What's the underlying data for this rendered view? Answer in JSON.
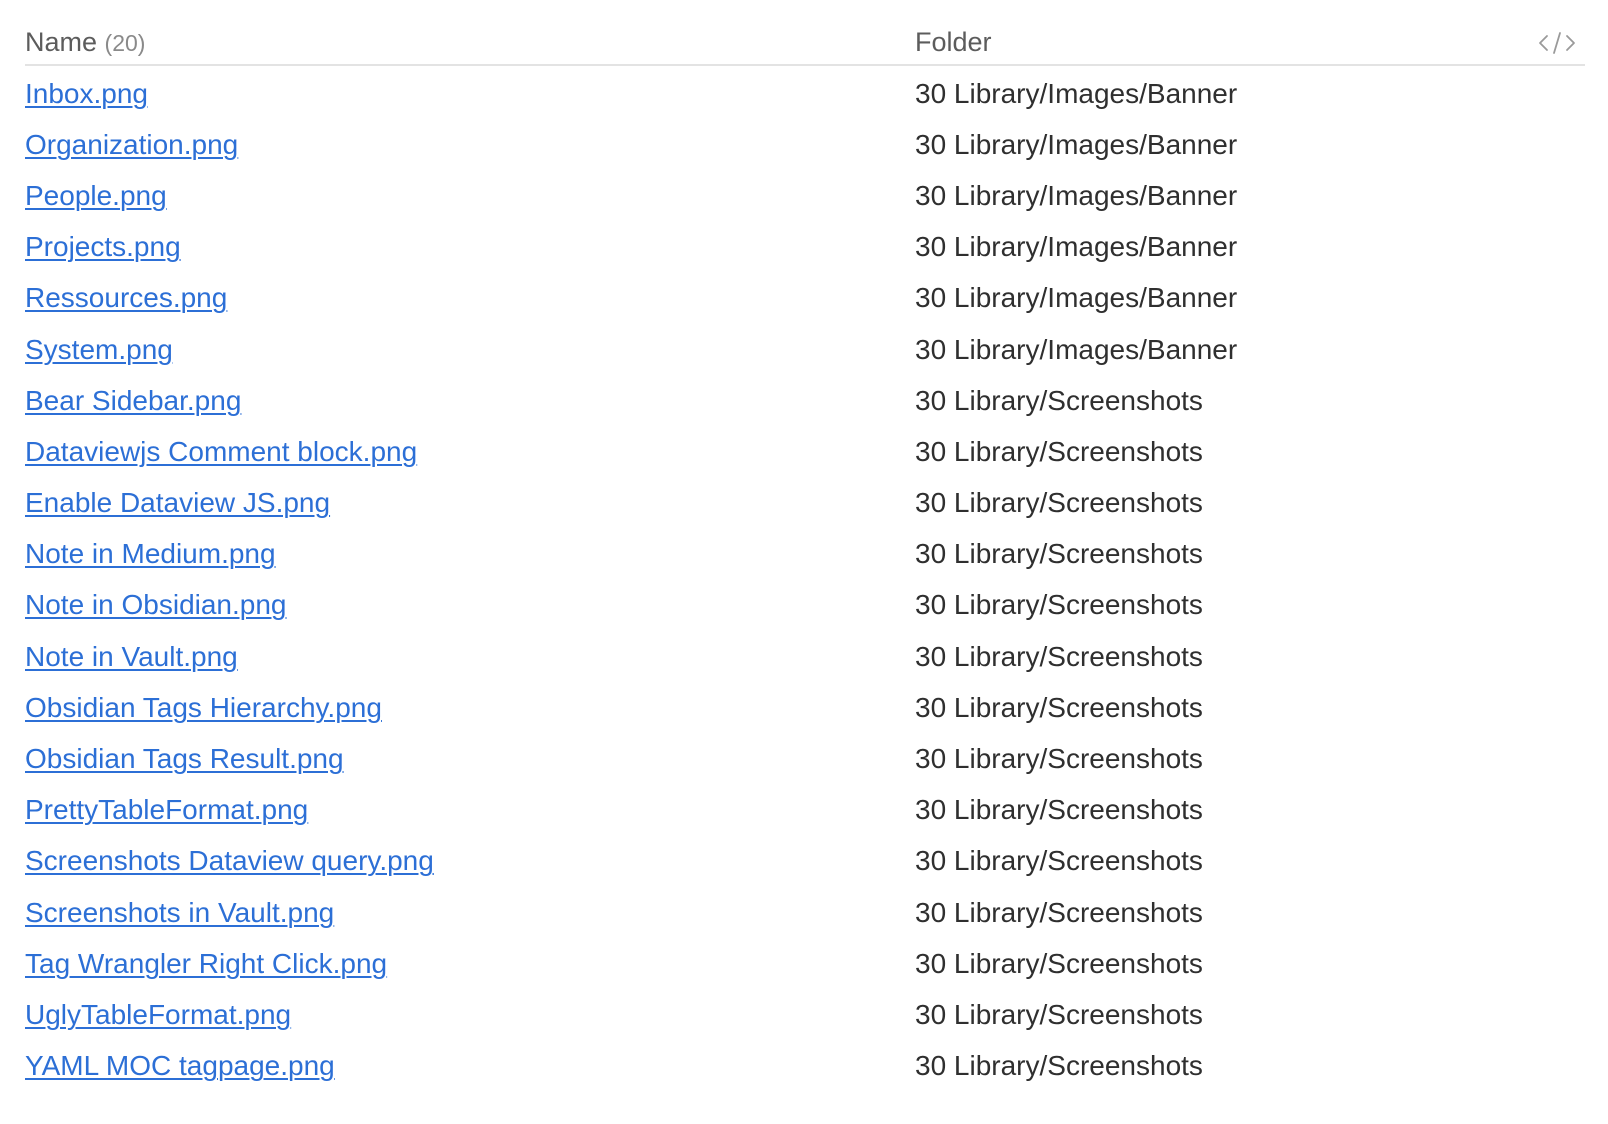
{
  "header": {
    "name_label": "Name",
    "count": "(20)",
    "folder_label": "Folder",
    "code_icon": "code-icon"
  },
  "colors": {
    "link": "#2c6fd6",
    "text": "#2f2f2f",
    "header": "#5c5c5c",
    "divider": "#e3e3e3"
  },
  "rows": [
    {
      "name": "Inbox.png",
      "folder": "30 Library/Images/Banner"
    },
    {
      "name": "Organization.png",
      "folder": "30 Library/Images/Banner"
    },
    {
      "name": "People.png",
      "folder": "30 Library/Images/Banner"
    },
    {
      "name": "Projects.png",
      "folder": "30 Library/Images/Banner"
    },
    {
      "name": "Ressources.png",
      "folder": "30 Library/Images/Banner"
    },
    {
      "name": "System.png",
      "folder": "30 Library/Images/Banner"
    },
    {
      "name": "Bear Sidebar.png",
      "folder": "30 Library/Screenshots"
    },
    {
      "name": "Dataviewjs Comment block.png",
      "folder": "30 Library/Screenshots"
    },
    {
      "name": "Enable Dataview JS.png",
      "folder": "30 Library/Screenshots"
    },
    {
      "name": "Note in Medium.png",
      "folder": "30 Library/Screenshots"
    },
    {
      "name": "Note in Obsidian.png",
      "folder": "30 Library/Screenshots"
    },
    {
      "name": "Note in Vault.png",
      "folder": "30 Library/Screenshots"
    },
    {
      "name": "Obsidian Tags Hierarchy.png",
      "folder": "30 Library/Screenshots"
    },
    {
      "name": "Obsidian Tags Result.png",
      "folder": "30 Library/Screenshots"
    },
    {
      "name": "PrettyTableFormat.png",
      "folder": "30 Library/Screenshots"
    },
    {
      "name": "Screenshots Dataview query.png",
      "folder": "30 Library/Screenshots"
    },
    {
      "name": "Screenshots in Vault.png",
      "folder": "30 Library/Screenshots"
    },
    {
      "name": "Tag Wrangler Right Click.png",
      "folder": "30 Library/Screenshots"
    },
    {
      "name": "UglyTableFormat.png",
      "folder": "30 Library/Screenshots"
    },
    {
      "name": "YAML MOC tagpage.png",
      "folder": "30 Library/Screenshots"
    }
  ]
}
